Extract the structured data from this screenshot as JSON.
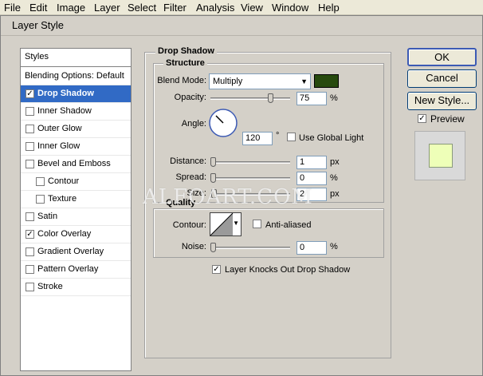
{
  "menubar": {
    "items": [
      "File",
      "Edit",
      "Image",
      "Layer",
      "Select",
      "Filter",
      "Analysis",
      "View",
      "Window",
      "Help"
    ]
  },
  "dialog": {
    "title": "Layer Style"
  },
  "styles_list": {
    "header": "Styles",
    "blending": "Blending Options: Default",
    "items": [
      {
        "label": "Drop Shadow",
        "checked": "✓"
      },
      {
        "label": "Inner Shadow",
        "checked": ""
      },
      {
        "label": "Outer Glow",
        "checked": ""
      },
      {
        "label": "Inner Glow",
        "checked": ""
      },
      {
        "label": "Bevel and Emboss",
        "checked": ""
      },
      {
        "label": "Contour",
        "checked": ""
      },
      {
        "label": "Texture",
        "checked": ""
      },
      {
        "label": "Satin",
        "checked": ""
      },
      {
        "label": "Color Overlay",
        "checked": "✓"
      },
      {
        "label": "Gradient Overlay",
        "checked": ""
      },
      {
        "label": "Pattern Overlay",
        "checked": ""
      },
      {
        "label": "Stroke",
        "checked": ""
      }
    ],
    "selected_index": 0
  },
  "drop_shadow": {
    "title": "Drop Shadow",
    "structure": {
      "title": "Structure",
      "blend_mode_label": "Blend Mode:",
      "blend_mode_value": "Multiply",
      "shadow_color": "#274a0e",
      "opacity_label": "Opacity:",
      "opacity_value": "75",
      "opacity_unit": "%",
      "angle_label": "Angle:",
      "angle_value": "120",
      "angle_unit": "°",
      "use_global_light_label": "Use Global Light",
      "use_global_light_checked": "",
      "distance_label": "Distance:",
      "distance_value": "1",
      "distance_unit": "px",
      "spread_label": "Spread:",
      "spread_value": "0",
      "spread_unit": "%",
      "size_label": "Size:",
      "size_value": "2",
      "size_unit": "px"
    },
    "quality": {
      "title": "Quality",
      "contour_label": "Contour:",
      "anti_aliased_label": "Anti-aliased",
      "anti_aliased_checked": "",
      "noise_label": "Noise:",
      "noise_value": "0",
      "noise_unit": "%"
    },
    "knocks_out_label": "Layer Knocks Out Drop Shadow",
    "knocks_out_checked": "✓"
  },
  "buttons": {
    "ok": "OK",
    "cancel": "Cancel",
    "new_style": "New Style...",
    "preview_label": "Preview",
    "preview_checked": "✓"
  },
  "preview_color": "#eeffb8",
  "watermark": "ALFOART.COM"
}
